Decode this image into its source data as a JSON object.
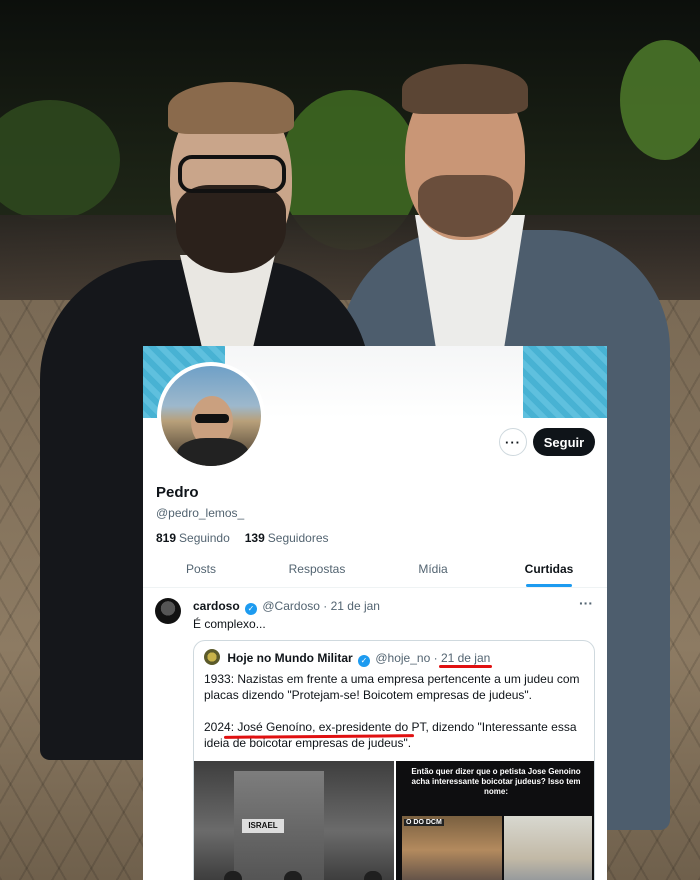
{
  "profile": {
    "name": "Pedro",
    "handle": "@pedro_lemos_",
    "following_count": "819",
    "following_label": "Seguindo",
    "followers_count": "139",
    "followers_label": "Seguidores",
    "more_label": "···",
    "follow_label": "Seguir"
  },
  "tabs": [
    {
      "label": "Posts"
    },
    {
      "label": "Respostas"
    },
    {
      "label": "Mídia"
    },
    {
      "label": "Curtidas"
    }
  ],
  "active_tab": "Curtidas",
  "tweet": {
    "author": "cardoso",
    "handle": "@Cardoso",
    "date": "· 21 de jan",
    "more_label": "···",
    "text": "É complexo..."
  },
  "quote": {
    "author": "Hoje no Mundo Militar",
    "handle": "@hoje_no ·",
    "date": "21 de jan",
    "p1": "1933: Nazistas em frente a uma empresa pertencente a um judeu com placas dizendo \"Protejam-se! Boicotem empresas de judeus\".",
    "p2": "2024: José Genoíno, ex-presidente do PT, dizendo \"Interessante essa ideia de boicotar empresas de judeus\".",
    "media_left_sign": "ISRAEL",
    "media_right_caption": "Então quer dizer que o petista Jose Genoino acha interessante boicotar judeus? Isso tem nome:",
    "media_right_tag": "O DO DCM"
  },
  "colors": {
    "accent": "#1d9bf0",
    "follow_button": "#0f1419",
    "highlight_underline": "#e01010"
  }
}
